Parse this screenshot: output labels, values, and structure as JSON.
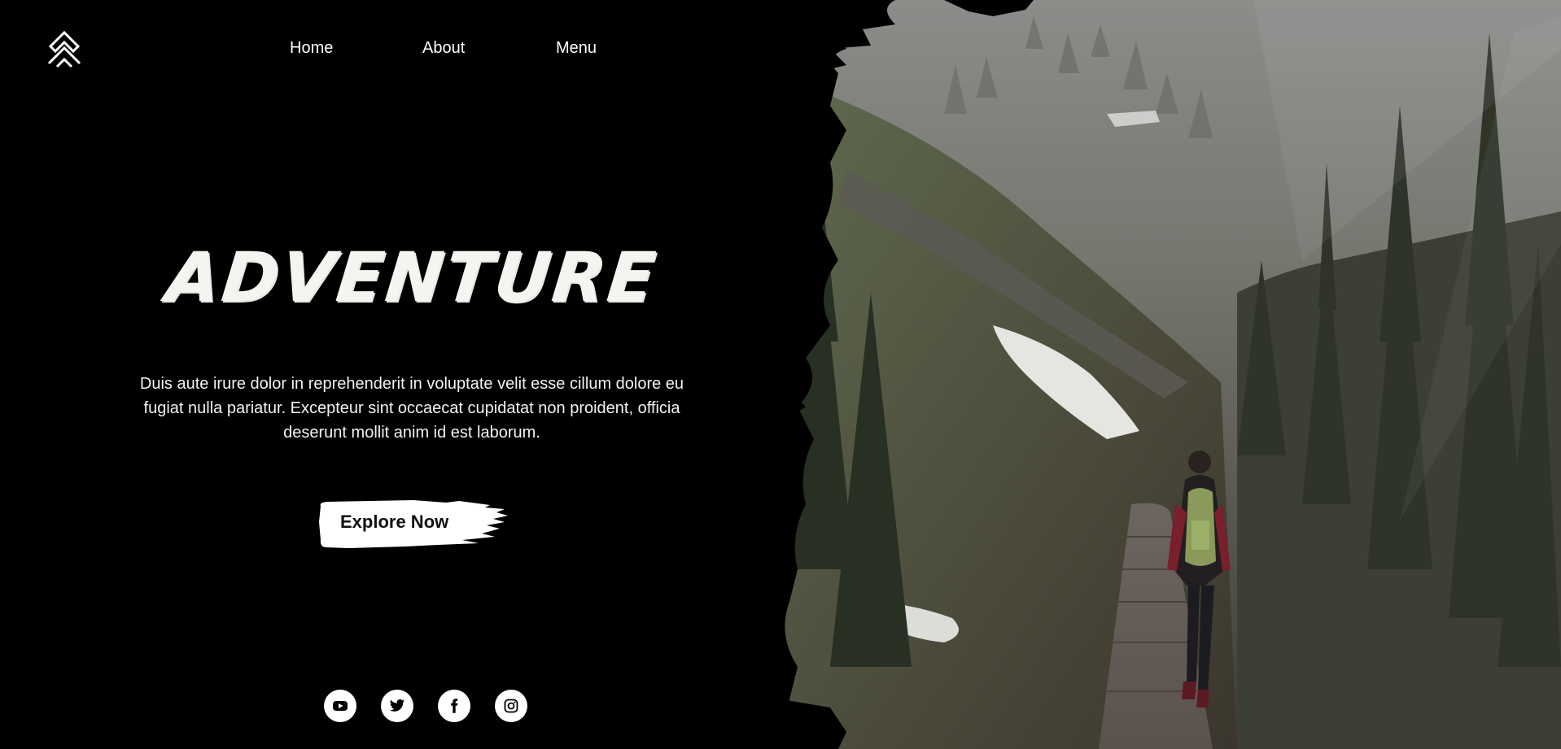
{
  "nav": {
    "items": [
      "Home",
      "About",
      "Menu"
    ]
  },
  "hero": {
    "title": "ADVENTURE",
    "body": "Duis aute irure dolor in reprehenderit in voluptate velit esse cillum dolore eu fugiat nulla pariatur. Excepteur sint occaecat cupidatat non proident, officia deserunt mollit anim id est laborum.",
    "cta": "Explore Now"
  },
  "socials": [
    "youtube-icon",
    "twitter-icon",
    "facebook-icon",
    "instagram-icon"
  ],
  "colors": {
    "background": "#000000",
    "text": "#ffffff",
    "button": "#ffffff",
    "button_text": "#111111"
  }
}
